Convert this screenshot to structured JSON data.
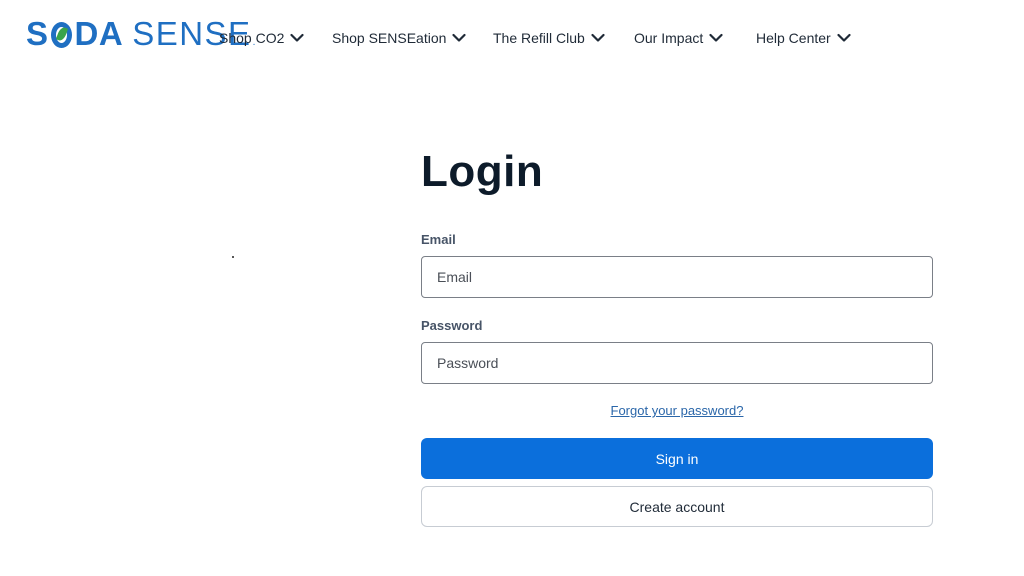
{
  "brand": {
    "logo_primary": "S",
    "logo_primary_tail": "DA",
    "logo_secondary": "SENSE",
    "logo_mark": ".",
    "brand_color": "#1f6fc2",
    "leaf_color": "#3aa44a"
  },
  "nav": {
    "items": [
      {
        "label": "Shop CO2",
        "icon": "chevron-down-icon"
      },
      {
        "label": "Shop SENSEation",
        "icon": "chevron-down-icon"
      },
      {
        "label": "The Refill Club",
        "icon": "chevron-down-icon"
      },
      {
        "label": "Our Impact",
        "icon": "chevron-down-icon"
      },
      {
        "label": "Help Center",
        "icon": "chevron-down-icon"
      }
    ]
  },
  "login": {
    "title": "Login",
    "email_label": "Email",
    "email_placeholder": "Email",
    "email_value": "",
    "password_label": "Password",
    "password_placeholder": "Password",
    "password_value": "",
    "forgot_link": "Forgot your password?",
    "sign_in_label": "Sign in",
    "create_account_label": "Create account",
    "primary_color": "#0b6fdc",
    "link_color": "#2a66a9"
  }
}
